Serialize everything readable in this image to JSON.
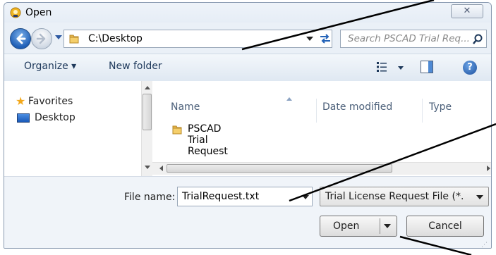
{
  "window": {
    "title": "Open",
    "close_glyph": "✕"
  },
  "address": {
    "path": "C:\\Desktop"
  },
  "search": {
    "placeholder": "Search PSCAD Trial Req..."
  },
  "toolbar": {
    "organize_label": "Organize ▾",
    "new_folder_label": "New folder",
    "help_glyph": "?"
  },
  "navigation": {
    "favorites_label": "Favorites",
    "desktop_label": "Desktop"
  },
  "file_list": {
    "columns": [
      "Name",
      "Date modified",
      "Type"
    ],
    "items": [
      {
        "name": "PSCAD Trial Request",
        "icon": "folder-icon"
      }
    ]
  },
  "footer": {
    "file_name_label": "File name:",
    "file_name_value": "TrialRequest.txt",
    "file_type_value": "Trial License Request File (*.",
    "open_label": "Open",
    "cancel_label": "Cancel"
  },
  "colors": {
    "accent": "#1e395b",
    "folder": "#e8b84a",
    "window_border": "#8a9bb1"
  }
}
